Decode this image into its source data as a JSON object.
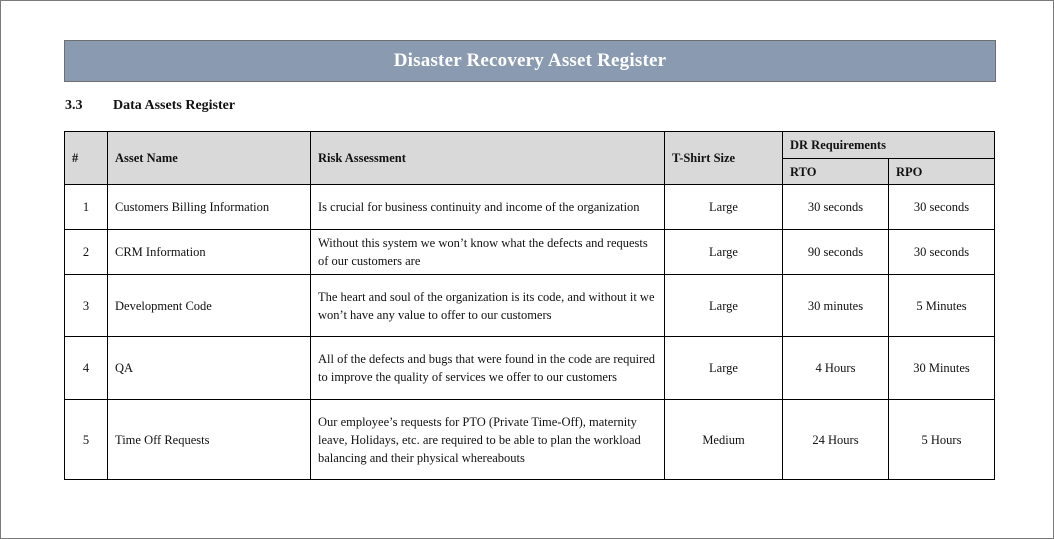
{
  "document": {
    "title": "Disaster Recovery Asset Register",
    "section": {
      "number": "3.3",
      "title": "Data Assets Register"
    }
  },
  "table": {
    "headers": {
      "number": "#",
      "asset_name": "Asset Name",
      "risk_assessment": "Risk Assessment",
      "tshirt_size": "T-Shirt Size",
      "dr_requirements": "DR Requirements",
      "rto": "RTO",
      "rpo": "RPO"
    },
    "rows": [
      {
        "number": "1",
        "asset_name": "Customers Billing Information",
        "risk_assessment": "Is crucial for business continuity and income of the organization",
        "tshirt_size": "Large",
        "rto": "30 seconds",
        "rpo": "30 seconds"
      },
      {
        "number": "2",
        "asset_name": "CRM Information",
        "risk_assessment": "Without this system we won’t know what the defects and requests of our customers are",
        "tshirt_size": "Large",
        "rto": "90 seconds",
        "rpo": "30 seconds"
      },
      {
        "number": "3",
        "asset_name": "Development Code",
        "risk_assessment": "The heart and soul of the organization is its code, and without it we won’t have any value to offer to our customers",
        "tshirt_size": "Large",
        "rto": "30 minutes",
        "rpo": "5 Minutes"
      },
      {
        "number": "4",
        "asset_name": "QA",
        "risk_assessment": "All of the defects and bugs that were found in the code are required to improve the quality of services we offer to our customers",
        "tshirt_size": "Large",
        "rto": "4 Hours",
        "rpo": "30 Minutes"
      },
      {
        "number": "5",
        "asset_name": "Time Off Requests",
        "risk_assessment": "Our employee’s requests for PTO (Private Time-Off), maternity leave, Holidays, etc. are required to be able to plan the workload balancing and their physical whereabouts",
        "tshirt_size": "Medium",
        "rto": "24 Hours",
        "rpo": "5 Hours"
      }
    ]
  },
  "colors": {
    "banner_background": "#8a9ab0",
    "banner_text": "#ffffff",
    "header_background": "#d9d9d9",
    "border": "#000000"
  }
}
